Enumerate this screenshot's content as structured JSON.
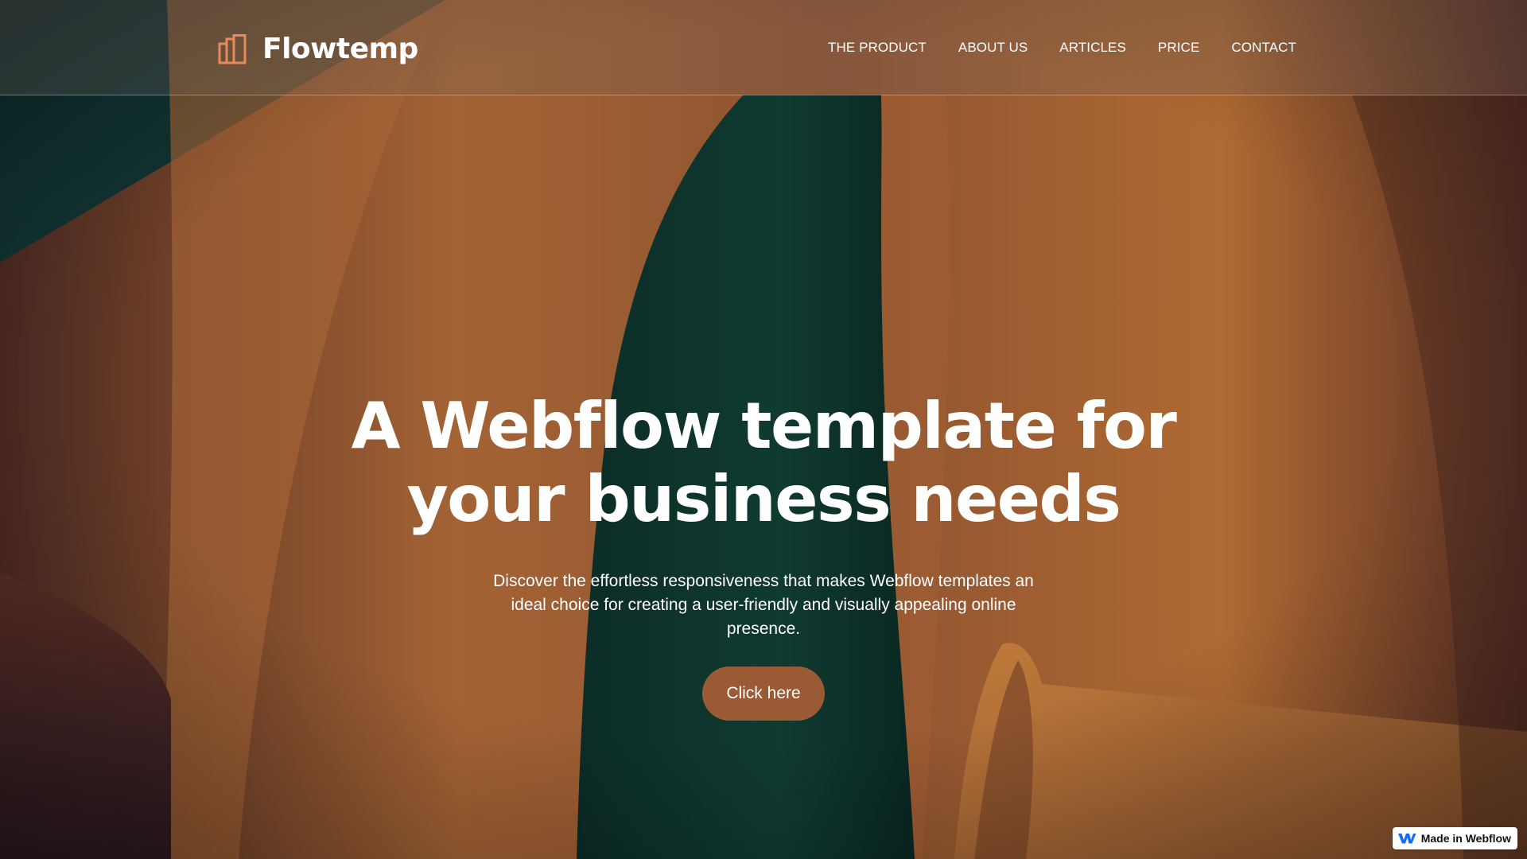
{
  "colors": {
    "accent": "#e88a5a",
    "button": "#9a5a33",
    "text": "#ffffff",
    "webflow_blue": "#146ef5"
  },
  "brand": {
    "name": "Flowtemp",
    "icon": "bar-chart-icon"
  },
  "nav": {
    "items": [
      {
        "label": "THE PRODUCT"
      },
      {
        "label": "ABOUT US"
      },
      {
        "label": "ARTICLES"
      },
      {
        "label": "PRICE"
      },
      {
        "label": "CONTACT"
      }
    ]
  },
  "hero": {
    "title_line1": "A Webflow template for",
    "title_line2": "your business needs",
    "subtitle": "Discover the effortless responsiveness that makes Webflow templates an ideal choice for creating a user-friendly and visually appealing online presence.",
    "button_label": "Click here"
  },
  "badge": {
    "label": "Made in Webflow",
    "icon": "webflow-logo-icon"
  }
}
